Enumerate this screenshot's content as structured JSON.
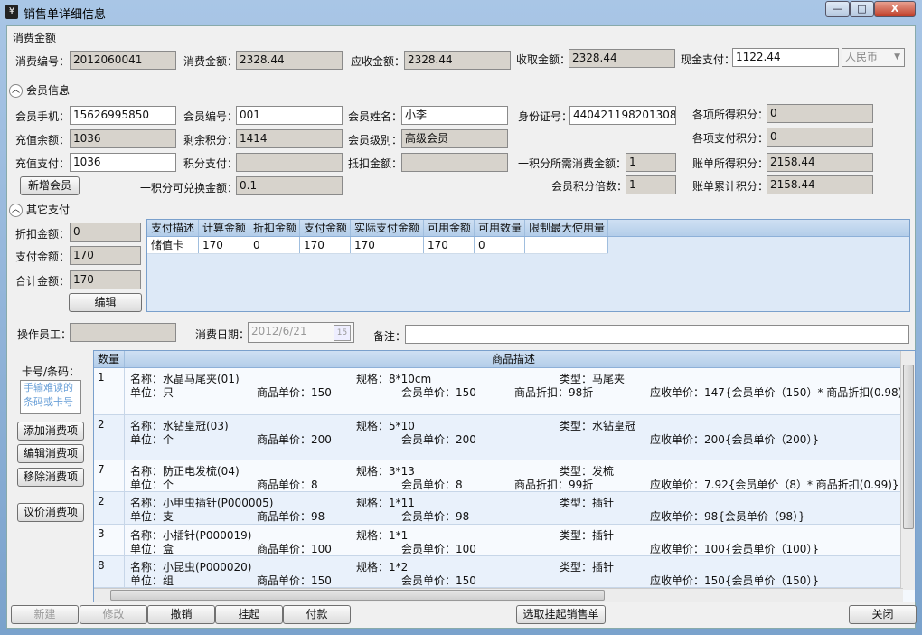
{
  "window": {
    "title": "销售单详细信息",
    "min": "—",
    "max": "□",
    "close": "X"
  },
  "consume": {
    "section": "消费金额",
    "no_label": "消费编号：",
    "no": "2012060041",
    "amount_label": "消费金额：",
    "amount": "2328.44",
    "due_label": "应收金额：",
    "due": "2328.44",
    "collected_label": "收取金额：",
    "collected": "2328.44",
    "cash_label": "现金支付：",
    "cash": "1122.44",
    "currency": "人民币"
  },
  "member": {
    "section": "会员信息",
    "phone_label": "会员手机：",
    "phone": "15626995850",
    "id_label": "会员编号：",
    "id": "001",
    "name_label": "会员姓名：",
    "name": "小李",
    "idcard_label": "身份证号：",
    "idcard": "440421198201308",
    "items_points_label": "各项所得积分：",
    "items_points": "0",
    "balance_label": "充值余额：",
    "balance": "1036",
    "remain_points_label": "剩余积分：",
    "remain_points": "1414",
    "level_label": "会员级别：",
    "level": "高级会员",
    "items_pay_points_label": "各项支付积分：",
    "items_pay_points": "0",
    "recharge_pay_label": "充值支付：",
    "recharge_pay": "1036",
    "points_pay_label": "积分支付：",
    "points_pay": "",
    "deduct_label": "抵扣金额：",
    "deduct": "",
    "per_point_spend_label": "一积分所需消费金额：",
    "per_point_spend": "1",
    "bill_points_label": "账单所得积分：",
    "bill_points": "2158.44",
    "add_btn": "新增会员",
    "point_exchange_label": "一积分可兑换金额：",
    "point_exchange": "0.1",
    "multiplier_label": "会员积分倍数：",
    "multiplier": "1",
    "bill_total_points_label": "账单累计积分：",
    "bill_total_points": "2158.44"
  },
  "other": {
    "section": "其它支付",
    "discount_label": "折扣金额：",
    "discount": "0",
    "pay_label": "支付金额：",
    "pay": "170",
    "total_label": "合计金额：",
    "total": "170",
    "edit_btn": "编辑",
    "columns": [
      "支付描述",
      "计算金额",
      "折扣金额",
      "支付金额",
      "实际支付金额",
      "可用金额",
      "可用数量",
      "限制最大使用量"
    ],
    "rows": [
      [
        "储值卡",
        "170",
        "0",
        "170",
        "170",
        "170",
        "0",
        ""
      ]
    ]
  },
  "staff": {
    "operator_label": "操作员工：",
    "operator": "",
    "date_label": "消费日期：",
    "date": "2012/6/21",
    "cal": "15",
    "note_label": "备注：",
    "note": ""
  },
  "side": {
    "card_label": "卡号/条码：",
    "card_placeholder": "手输难读的条码或卡号",
    "add": "添加消费项",
    "edit": "编辑消费项",
    "remove": "移除消费项",
    "negotiate": "议价消费项"
  },
  "products": {
    "col_qty": "数量",
    "col_desc": "商品描述",
    "rows": [
      {
        "qty": "1",
        "name": "名称：水晶马尾夹(01)",
        "spec": "规格：8*10cm",
        "type": "类型：马尾夹",
        "unit": "单位：只",
        "price": "商品单价：150",
        "mprice": "会员单价：150",
        "disc": "商品折扣：98折",
        "due": "应收单价：147{会员单价（150）* 商品折扣(0.98)}"
      },
      {
        "qty": "2",
        "name": "名称：水钻皇冠(03)",
        "spec": "规格：5*10",
        "type": "类型：水钻皇冠",
        "unit": "单位：个",
        "price": "商品单价：200",
        "mprice": "会员单价：200",
        "disc": "",
        "due": "应收单价：200{会员单价（200）}"
      },
      {
        "qty": "7",
        "name": "名称：防正电发梳(04)",
        "spec": "规格：3*13",
        "type": "类型：发梳",
        "unit": "单位：个",
        "price": "商品单价：8",
        "mprice": "会员单价：8",
        "disc": "商品折扣：99折",
        "due": "应收单价：7.92{会员单价（8）* 商品折扣(0.99)}"
      },
      {
        "qty": "2",
        "name": "名称：小甲虫插针(P000005)",
        "spec": "规格：1*11",
        "type": "类型：插针",
        "unit": "单位：支",
        "price": "商品单价：98",
        "mprice": "会员单价：98",
        "disc": "",
        "due": "应收单价：98{会员单价（98）}"
      },
      {
        "qty": "3",
        "name": "名称：小插针(P000019)",
        "spec": "规格：1*1",
        "type": "类型：插针",
        "unit": "单位：盒",
        "price": "商品单价：100",
        "mprice": "会员单价：100",
        "disc": "",
        "due": "应收单价：100{会员单价（100）}"
      },
      {
        "qty": "8",
        "name": "名称：小昆虫(P000020)",
        "spec": "规格：1*2",
        "type": "类型：插针",
        "unit": "单位：组",
        "price": "商品单价：150",
        "mprice": "会员单价：150",
        "disc": "",
        "due": "应收单价：150{会员单价（150）}"
      }
    ]
  },
  "footer": {
    "new": "新建",
    "modify": "修改",
    "undo": "撤销",
    "hang": "挂起",
    "pay": "付款",
    "pick": "选取挂起销售单",
    "close": "关闭"
  }
}
